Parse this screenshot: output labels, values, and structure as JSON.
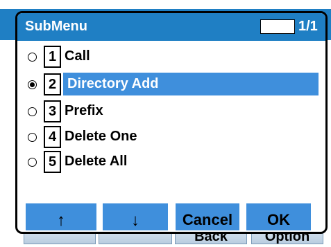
{
  "dialog": {
    "title": "SubMenu",
    "page_indicator": "1/1"
  },
  "menu": {
    "items": [
      {
        "number": "1",
        "label": "Call",
        "selected": false
      },
      {
        "number": "2",
        "label": "Directory Add",
        "selected": true
      },
      {
        "number": "3",
        "label": "Prefix",
        "selected": false
      },
      {
        "number": "4",
        "label": "Delete One",
        "selected": false
      },
      {
        "number": "5",
        "label": "Delete All",
        "selected": false
      }
    ]
  },
  "softkeys": {
    "up": "↑",
    "down": "↓",
    "cancel": "Cancel",
    "ok": "OK"
  },
  "background": {
    "softkeys": [
      "",
      "",
      "Back",
      "Option"
    ]
  },
  "colors": {
    "title_bar": "#1f7fc4",
    "highlight": "#3f8fdc",
    "softkey": "#3f8fdc"
  }
}
